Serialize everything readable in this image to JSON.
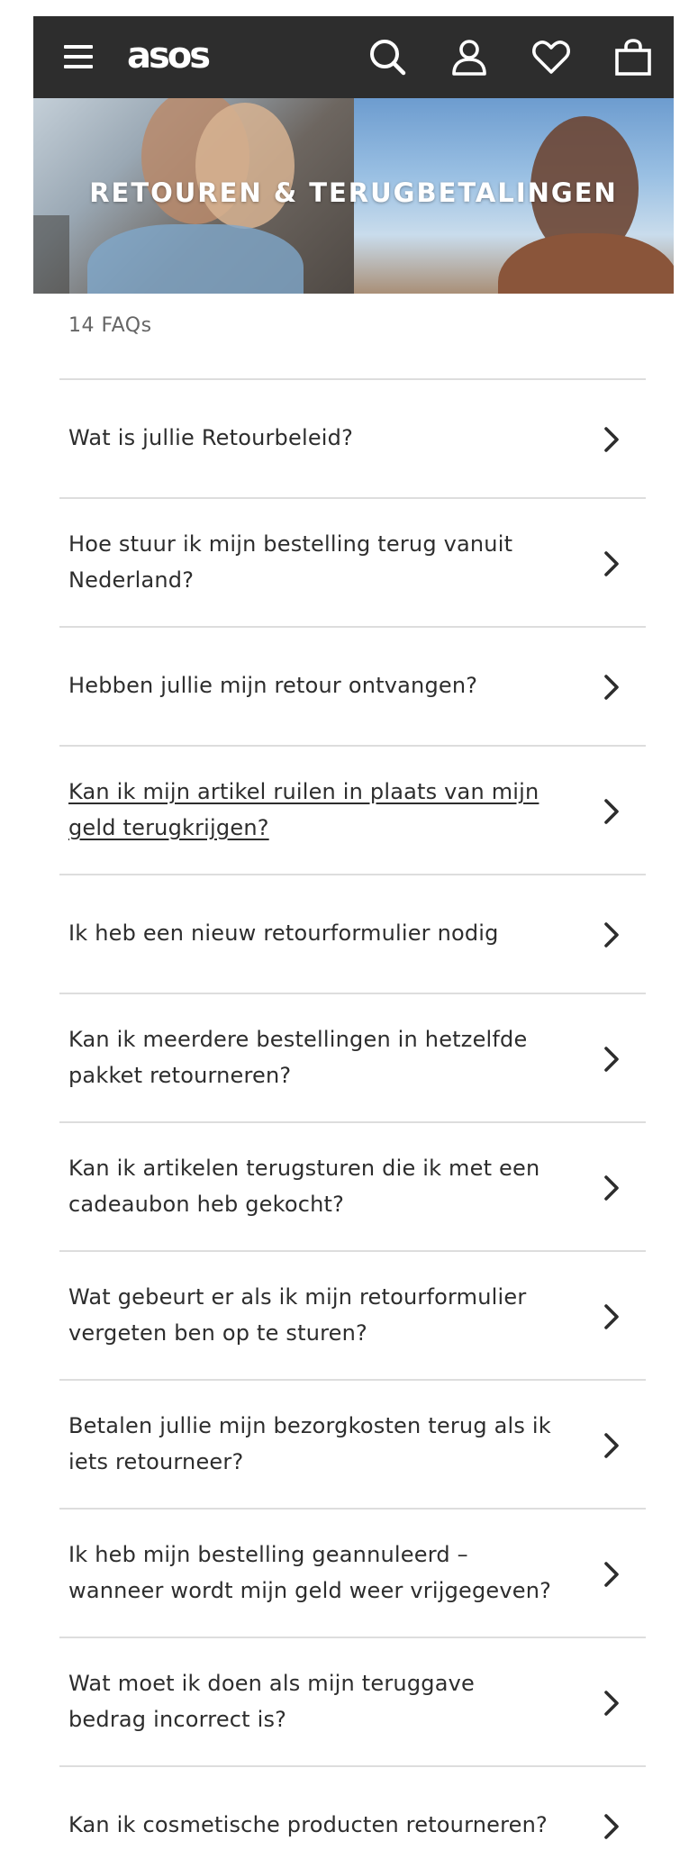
{
  "header": {
    "logo": "asos",
    "icons": [
      "menu-icon",
      "search-icon",
      "account-icon",
      "heart-icon",
      "bag-icon"
    ]
  },
  "hero": {
    "title": "RETOUREN & TERUGBETALINGEN"
  },
  "faq": {
    "count_label": "14 FAQs",
    "items": [
      {
        "label": "Wat is jullie Retourbeleid?"
      },
      {
        "label": "Hoe stuur ik mijn bestelling terug vanuit Nederland?"
      },
      {
        "label": "Hebben jullie mijn retour ontvangen?"
      },
      {
        "label": "Kan ik mijn artikel ruilen in plaats van mijn geld terugkrijgen?"
      },
      {
        "label": "Ik heb een nieuw retourformulier nodig"
      },
      {
        "label": "Kan ik meerdere bestellingen in hetzelfde pakket retourneren?"
      },
      {
        "label": "Kan ik artikelen terugsturen die ik met een cadeaubon heb gekocht?"
      },
      {
        "label": "Wat gebeurt er als ik mijn retourformulier vergeten ben op te sturen?"
      },
      {
        "label": "Betalen jullie mijn bezorgkosten terug als ik iets retourneer?"
      },
      {
        "label": "Ik heb mijn bestelling geannuleerd – wanneer wordt mijn geld weer vrijgegeven?"
      },
      {
        "label": "Wat moet ik doen als mijn teruggave bedrag incorrect is?"
      },
      {
        "label": "Kan ik cosmetische producten retourneren?"
      }
    ]
  },
  "colors": {
    "header_bg": "#2d2d2d",
    "text": "#2d2d2d",
    "muted": "#666666",
    "divider": "#dddddd"
  }
}
